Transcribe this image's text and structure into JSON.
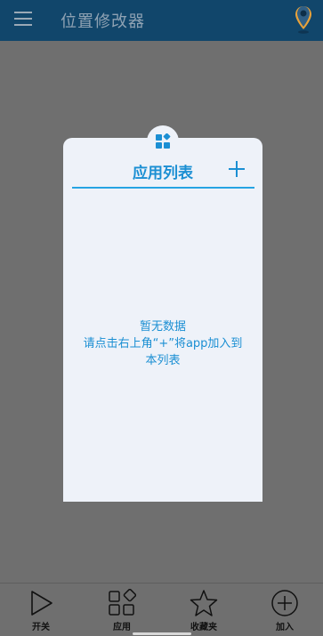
{
  "header": {
    "title": "位置修改器",
    "menu_icon": "hamburger-menu-icon",
    "pin_icon": "location-pin-icon"
  },
  "app_list": {
    "title": "应用列表",
    "badge_icon": "apps-grid-icon",
    "add_icon": "plus-icon",
    "empty_line1": "暂无数据",
    "empty_line2": "请点击右上角“+”将app加入到",
    "empty_line3": "本列表"
  },
  "bottom_nav": {
    "items": [
      {
        "label": "开关",
        "icon": "play-icon"
      },
      {
        "label": "应用",
        "icon": "apps-icon"
      },
      {
        "label": "收藏夹",
        "icon": "star-icon"
      },
      {
        "label": "加入",
        "icon": "add-circle-icon"
      }
    ]
  },
  "colors": {
    "header_bg": "#11466b",
    "accent": "#1b8fd3",
    "overlay": "#6f6f6f",
    "card_bg": "#eef2f9"
  }
}
